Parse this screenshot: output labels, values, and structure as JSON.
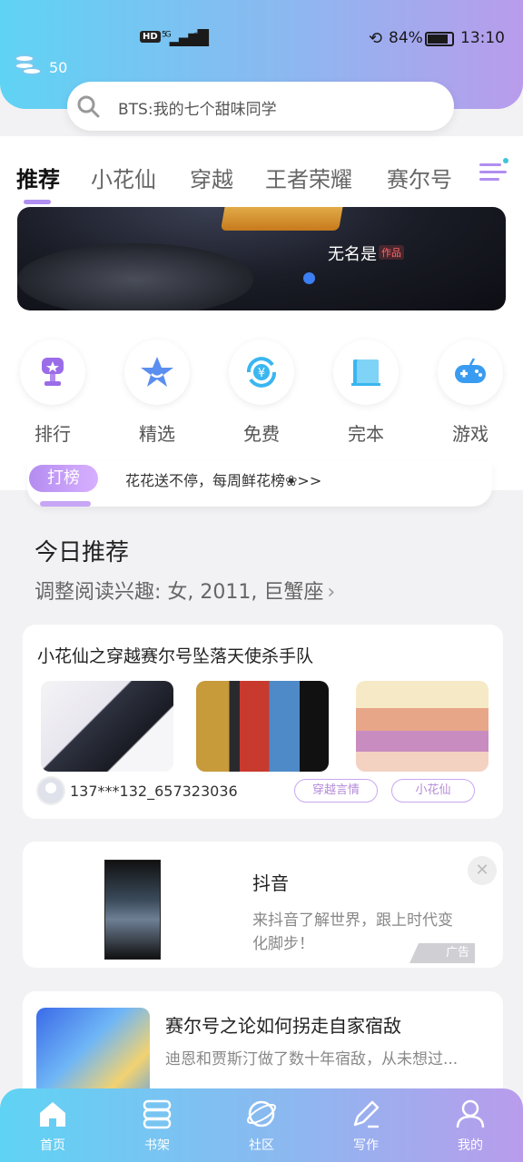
{
  "status_bar": {
    "hd": "HD",
    "signal": "5G",
    "battery": "84%",
    "time": "13:10"
  },
  "coins": {
    "count": "50",
    "icon": "coins-icon"
  },
  "search": {
    "placeholder": "BTS:我的七个甜味同学",
    "icon": "search-icon"
  },
  "tabs": [
    {
      "label": "推荐",
      "active": true
    },
    {
      "label": "小花仙"
    },
    {
      "label": "穿越"
    },
    {
      "label": "王者荣耀"
    },
    {
      "label": "赛尔号"
    }
  ],
  "banner": {
    "title": "无名是",
    "tag": "作品"
  },
  "quick_nav": [
    {
      "label": "排行",
      "icon": "trophy-icon",
      "color": "#9b6ce8"
    },
    {
      "label": "精选",
      "icon": "star-icon",
      "color": "#5a8ff0"
    },
    {
      "label": "免费",
      "icon": "yen-refresh-icon",
      "color": "#3ab6f0"
    },
    {
      "label": "完本",
      "icon": "book-icon",
      "color": "#3ab6f0"
    },
    {
      "label": "游戏",
      "icon": "gamepad-icon",
      "color": "#3a9cf0"
    }
  ],
  "notice": {
    "badge": "打榜",
    "text": "花花送不停，每周鲜花榜❀>>"
  },
  "recommend": {
    "title": "今日推荐",
    "subtitle": "调整阅读兴趣: 女, 2011, 巨蟹座"
  },
  "card1": {
    "title": "小花仙之穿越赛尔号坠落天使杀手队",
    "author": "137***132_657323036",
    "tags": [
      "穿越言情",
      "小花仙"
    ]
  },
  "ad": {
    "title": "抖音",
    "description": "来抖音了解世界，跟上时代变化脚步！",
    "mark": "广告",
    "close": "✕"
  },
  "card3": {
    "title": "赛尔号之论如何拐走自家宿敌",
    "description": "迪恩和贾斯汀做了数十年宿敌，从未想过..."
  },
  "bottom_nav": [
    {
      "label": "首页",
      "icon": "home-icon"
    },
    {
      "label": "书架",
      "icon": "bookshelf-icon"
    },
    {
      "label": "社区",
      "icon": "planet-icon"
    },
    {
      "label": "写作",
      "icon": "pen-icon"
    },
    {
      "label": "我的",
      "icon": "user-icon"
    }
  ],
  "colors": {
    "accent": "#b08ff0",
    "header_gradient": [
      "#5fd3f4",
      "#8cb8f0",
      "#b99cec"
    ]
  }
}
